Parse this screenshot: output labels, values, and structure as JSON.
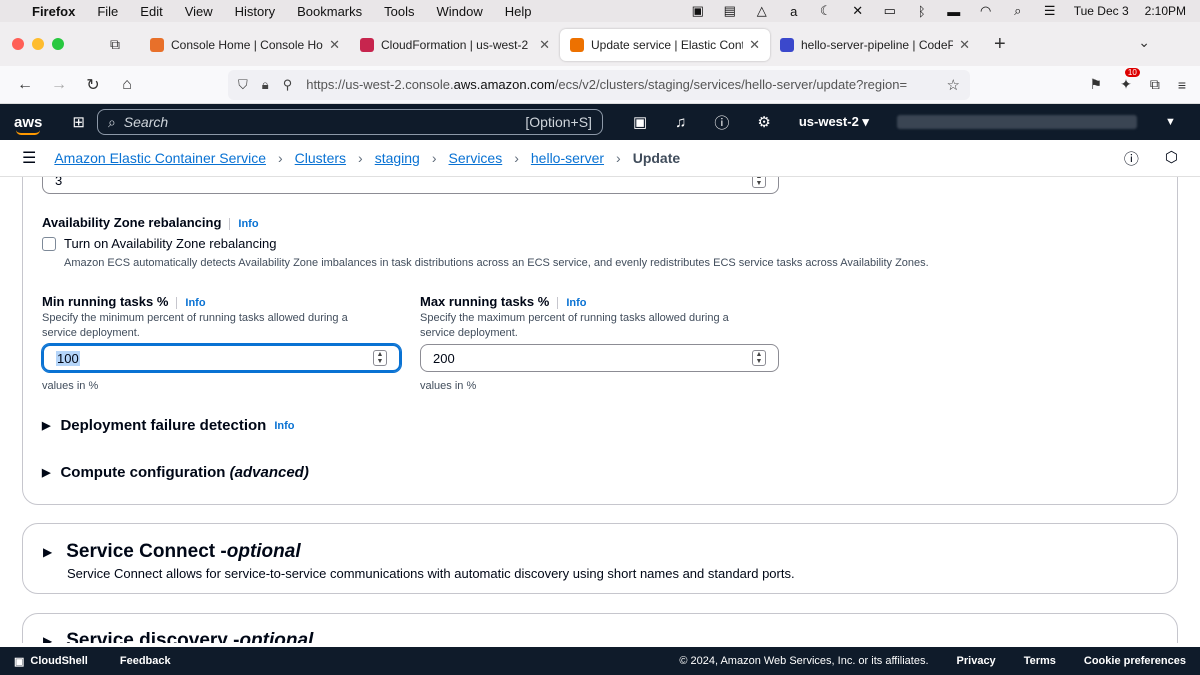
{
  "menubar": {
    "app": "Firefox",
    "items": [
      "File",
      "Edit",
      "View",
      "History",
      "Bookmarks",
      "Tools",
      "Window",
      "Help"
    ],
    "date": "Tue Dec 3",
    "time": "2:10PM"
  },
  "tabs": [
    {
      "title": "Console Home | Console Home",
      "color": "#e8702a"
    },
    {
      "title": "CloudFormation | us-west-2",
      "color": "#c7254e"
    },
    {
      "title": "Update service | Elastic Contain",
      "color": "#ed7100"
    },
    {
      "title": "hello-server-pipeline | CodePipe",
      "color": "#3b48cc"
    }
  ],
  "url": {
    "prefix": "https://us-west-2.console.",
    "domain": "aws.amazon.com",
    "path": "/ecs/v2/clusters/staging/services/hello-server/update?region="
  },
  "extension_badge": "10",
  "aws": {
    "search_placeholder": "Search",
    "search_shortcut": "[Option+S]",
    "region": "us-west-2"
  },
  "breadcrumb": {
    "items": [
      "Amazon Elastic Container Service",
      "Clusters",
      "staging",
      "Services",
      "hello-server"
    ],
    "current": "Update"
  },
  "form": {
    "top_value": "3",
    "az_rebalancing": {
      "label": "Availability Zone rebalancing",
      "info": "Info",
      "checkbox_label": "Turn on Availability Zone rebalancing",
      "description": "Amazon ECS automatically detects Availability Zone imbalances in task distributions across an ECS service, and evenly redistributes ECS service tasks across Availability Zones."
    },
    "min_tasks": {
      "label": "Min running tasks %",
      "info": "Info",
      "description": "Specify the minimum percent of running tasks allowed during a service deployment.",
      "value": "100",
      "hint": "values in %"
    },
    "max_tasks": {
      "label": "Max running tasks %",
      "info": "Info",
      "description": "Specify the maximum percent of running tasks allowed during a service deployment.",
      "value": "200",
      "hint": "values in %"
    },
    "deployment_failure": {
      "label": "Deployment failure detection",
      "info": "Info"
    },
    "compute_config": {
      "label": "Compute configuration",
      "suffix": "(advanced)"
    }
  },
  "service_connect": {
    "title": "Service Connect - ",
    "optional": "optional",
    "description": "Service Connect allows for service-to-service communications with automatic discovery using short names and standard ports."
  },
  "service_discovery": {
    "title": "Service discovery - ",
    "optional": "optional"
  },
  "footer": {
    "cloudshell": "CloudShell",
    "feedback": "Feedback",
    "copyright": "© 2024, Amazon Web Services, Inc. or its affiliates.",
    "privacy": "Privacy",
    "terms": "Terms",
    "cookies": "Cookie preferences"
  }
}
